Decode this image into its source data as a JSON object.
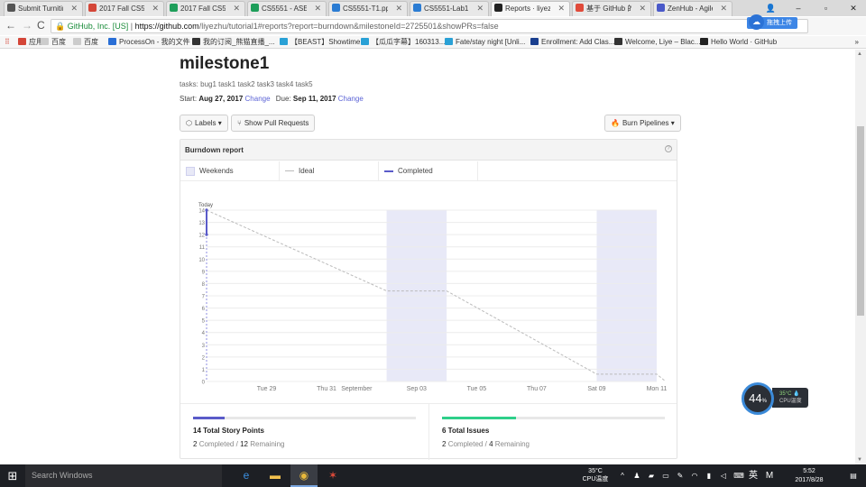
{
  "browser": {
    "tabs": [
      {
        "title": "Submit Turnitin",
        "icon_color": "#555555"
      },
      {
        "title": "2017 Fall CS55...",
        "icon_color": "#d44638"
      },
      {
        "title": "2017 Fall CS55...",
        "icon_color": "#1e9e5a"
      },
      {
        "title": "CS5551 - ASE 2...",
        "icon_color": "#1e9e5a"
      },
      {
        "title": "CS5551-T1.ppt",
        "icon_color": "#2b7cd3"
      },
      {
        "title": "CS5551-Lab1.d...",
        "icon_color": "#2b7cd3"
      },
      {
        "title": "Reports · liyezh...",
        "icon_color": "#222222"
      },
      {
        "title": "基于 GitHub 的...",
        "icon_color": "#e04a3a"
      },
      {
        "title": "ZenHub - Agile...",
        "icon_color": "#4a59c9"
      }
    ],
    "window_buttons": {
      "user": "👤",
      "minimize": "–",
      "maximize": "▫",
      "close": "✕"
    },
    "address": {
      "org": "GitHub, Inc. [US]",
      "separator": "|",
      "host": "https://github.com",
      "path": "/liyezhu/tutorial1#reports?report=burndown&milestoneId=2725501&showPRs=false"
    },
    "upload_button": "拖拽上传",
    "bookmarks": [
      {
        "label": "应用",
        "icon_color": "#d44638"
      },
      {
        "label": "百度",
        "icon_color": "#cccccc"
      },
      {
        "label": "百度",
        "icon_color": "#cccccc"
      },
      {
        "label": "ProcessOn - 我的文件",
        "icon_color": "#2a6fd6"
      },
      {
        "label": "我的订阅_熊猫直播_...",
        "icon_color": "#333333"
      },
      {
        "label": "【BEAST】Showtime",
        "icon_color": "#2aa1d6"
      },
      {
        "label": "【瓜瓜字幕】160313...",
        "icon_color": "#2aa1d6"
      },
      {
        "label": "Fate/stay night [Unli...",
        "icon_color": "#2aa1d6"
      },
      {
        "label": "Enrollment: Add Clas...",
        "icon_color": "#1a3f8f"
      },
      {
        "label": "Welcome, Liye – Blac...",
        "icon_color": "#333333"
      },
      {
        "label": "Hello World · GitHub",
        "icon_color": "#222222"
      }
    ],
    "more_bookmarks": "»"
  },
  "milestone": {
    "title": "milestone1",
    "tasks_line": "tasks: bug1 task1 task2 task3 task4 task5",
    "start_label": "Start:",
    "start_date": "Aug 27, 2017",
    "change_label": "Change",
    "due_label": "Due:",
    "due_date": "Sep 11, 2017"
  },
  "toolbar": {
    "labels_button": "Labels",
    "show_pr_button": "Show Pull Requests",
    "burn_pipelines_button": "Burn Pipelines"
  },
  "report": {
    "title": "Burndown report",
    "help": "?",
    "legend": [
      {
        "label": "Weekends",
        "color": "#e8e9f7"
      },
      {
        "label": "Ideal",
        "color": "#bbbbbb"
      },
      {
        "label": "Completed",
        "color": "#5a5bc9"
      }
    ],
    "stats": [
      {
        "title": "14 Total Story Points",
        "completed": "2",
        "completed_label": "Completed",
        "sep": "/",
        "remaining": "12",
        "remaining_label": "Remaining",
        "fraction": 0.1429,
        "color": "#5a5bc9"
      },
      {
        "title": "6 Total Issues",
        "completed": "2",
        "completed_label": "Completed",
        "sep": "/",
        "remaining": "4",
        "remaining_label": "Remaining",
        "fraction": 0.3333,
        "color": "#2fcf8a"
      }
    ]
  },
  "chart_data": {
    "type": "line",
    "title": "",
    "xlabel": "",
    "ylabel": "",
    "ylim": [
      0,
      14
    ],
    "yticks": [
      0,
      1,
      2,
      3,
      4,
      5,
      6,
      7,
      8,
      9,
      10,
      11,
      12,
      13,
      14
    ],
    "x": [
      "Aug 27",
      "Aug 28",
      "Aug 29",
      "Aug 30",
      "Aug 31",
      "Sep 01",
      "Sep 02",
      "Sep 03",
      "Sep 04",
      "Sep 05",
      "Sep 06",
      "Sep 07",
      "Sep 08",
      "Sep 09",
      "Sep 10",
      "Sep 11"
    ],
    "xtick_labels": [
      {
        "x": "Aug 29",
        "label": "Tue 29"
      },
      {
        "x": "Aug 31",
        "label": "Thu 31"
      },
      {
        "x": "Sep 01",
        "label": "September"
      },
      {
        "x": "Sep 03",
        "label": "Sep 03"
      },
      {
        "x": "Sep 05",
        "label": "Tue 05"
      },
      {
        "x": "Sep 07",
        "label": "Thu 07"
      },
      {
        "x": "Sep 09",
        "label": "Sat 09"
      },
      {
        "x": "Sep 11",
        "label": "Mon 11"
      }
    ],
    "weekends": [
      [
        "Sep 02",
        "Sep 04"
      ],
      [
        "Sep 09",
        "Sep 11"
      ]
    ],
    "today": {
      "x": "Aug 27",
      "label": "Today"
    },
    "series": [
      {
        "name": "Ideal",
        "color": "#bbbbbb",
        "dashed": true,
        "points": [
          [
            "Aug 27",
            14
          ],
          [
            "Sep 02",
            7.4
          ],
          [
            "Sep 04",
            7.4
          ],
          [
            "Sep 09",
            0.6
          ],
          [
            "Sep 11",
            0.6
          ],
          [
            "Sep 11.3",
            0
          ]
        ]
      },
      {
        "name": "Completed",
        "color": "#5a5bc9",
        "dashed": false,
        "points": [
          [
            "Aug 27",
            14
          ],
          [
            "Aug 27",
            12
          ]
        ]
      }
    ],
    "grid": true
  },
  "cpu_widget": {
    "usage": "44",
    "unit": "%",
    "temp": "35°C",
    "label": "CPU温度"
  },
  "taskbar": {
    "search_placeholder": "Search Windows",
    "apps": [
      {
        "name": "edge",
        "glyph": "e",
        "color": "#3b8fe0"
      },
      {
        "name": "explorer",
        "glyph": "▬",
        "color": "#f2c14e"
      },
      {
        "name": "chrome",
        "glyph": "◉",
        "color": "#e8b93b"
      },
      {
        "name": "paint",
        "glyph": "✶",
        "color": "#e04a3a"
      }
    ],
    "tray": {
      "temp": "35°C",
      "temp_label": "CPU温度",
      "ime": "英",
      "ime2": "M",
      "time": "5:52",
      "date": "2017/8/28"
    }
  }
}
